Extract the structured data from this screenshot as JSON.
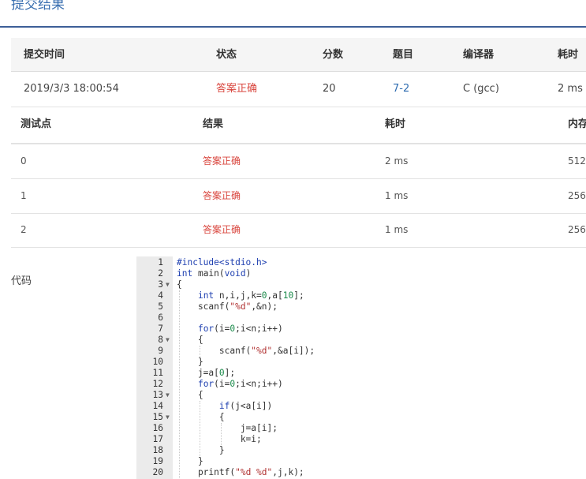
{
  "page": {
    "title": "提交结果"
  },
  "summary": {
    "headers": [
      "提交时间",
      "状态",
      "分数",
      "题目",
      "编译器",
      "耗时"
    ],
    "row": {
      "time": "2019/3/3 18:00:54",
      "status": "答案正确",
      "score": "20",
      "problem": "7-2",
      "compiler": "C (gcc)",
      "duration": "2 ms"
    }
  },
  "cases": {
    "headers": [
      "测试点",
      "结果",
      "耗时",
      "内存"
    ],
    "rows": [
      {
        "id": "0",
        "result": "答案正确",
        "time": "2 ms",
        "memory": "512"
      },
      {
        "id": "1",
        "result": "答案正确",
        "time": "1 ms",
        "memory": "256"
      },
      {
        "id": "2",
        "result": "答案正确",
        "time": "1 ms",
        "memory": "256"
      }
    ]
  },
  "code": {
    "label": "代码",
    "lines": [
      "#include<stdio.h>",
      "int main(void)",
      "{",
      "    int n,i,j,k=0,a[10];",
      "    scanf(\"%d\",&n);",
      "",
      "    for(i=0;i<n;i++)",
      "    {",
      "        scanf(\"%d\",&a[i]);",
      "    }",
      "    j=a[0];",
      "    for(i=0;i<n;i++)",
      "    {",
      "        if(j<a[i])",
      "        {",
      "            j=a[i];",
      "            k=i;",
      "        }",
      "    }",
      "    printf(\"%d %d\",j,k);"
    ],
    "folded_lines": [
      3,
      8,
      13,
      15
    ]
  },
  "colors": {
    "accent": "#3a6fb0",
    "status_ok": "#d9453d",
    "link": "#2d6bb0"
  }
}
